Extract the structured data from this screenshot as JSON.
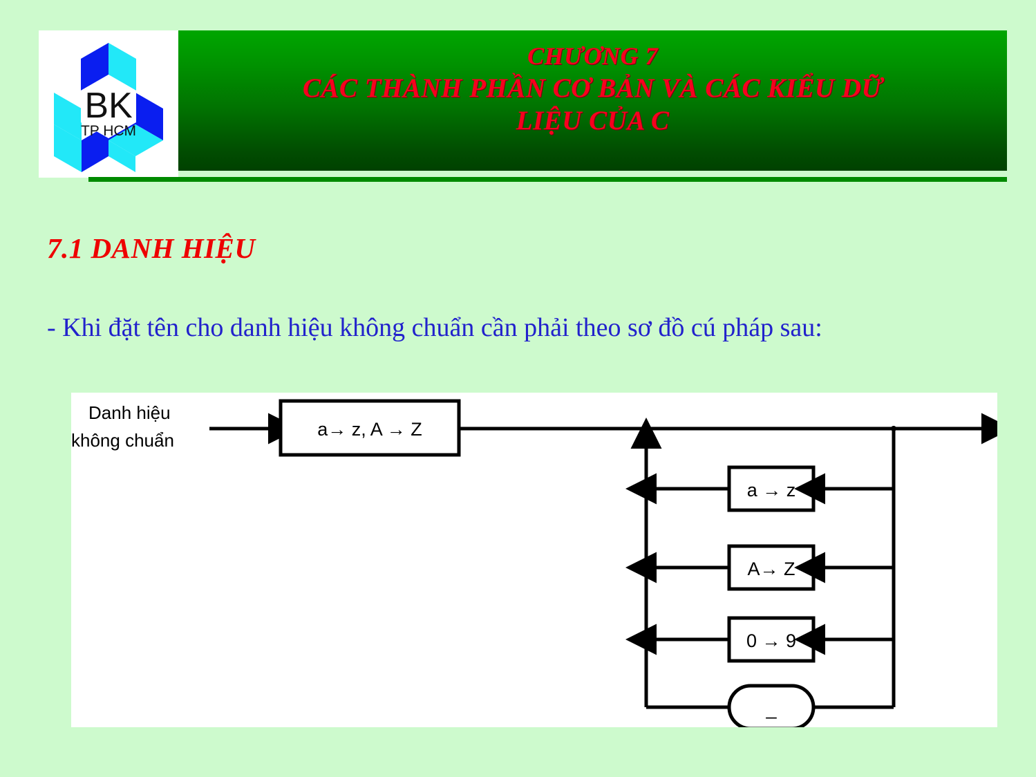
{
  "slide": {
    "background_color": "#cdfacd",
    "accent_red": "#ee0000",
    "accent_blue": "#2222cc",
    "header_green_top": "#00a600",
    "header_green_bottom": "#004100"
  },
  "logo": {
    "name": "bk-tphcm-logo",
    "primary_text": "BK",
    "secondary_text": "TP HCM",
    "color_blue": "#0a1ef0",
    "color_cyan": "#22e8f8"
  },
  "header": {
    "line1": "CHƯƠNG 7",
    "line2": "CÁC THÀNH PHẦN CƠ BẢN VÀ CÁC KIỂU DỮ",
    "line3": "LIỆU CỦA C"
  },
  "content": {
    "section_heading": "7.1 DANH HIỆU",
    "paragraph": "- Khi đặt tên cho danh hiệu không chuẩn cần phải theo sơ đồ cú pháp sau:"
  },
  "diagram": {
    "type": "syntax-railroad-diagram",
    "entry_label_line1": "Danh hiệu",
    "entry_label_line2": "không chuẩn",
    "first_box": "a→  z,   A → Z",
    "loop_boxes": [
      "a →  z",
      "A→  Z",
      "0 →  9"
    ],
    "loop_terminal": "_"
  }
}
